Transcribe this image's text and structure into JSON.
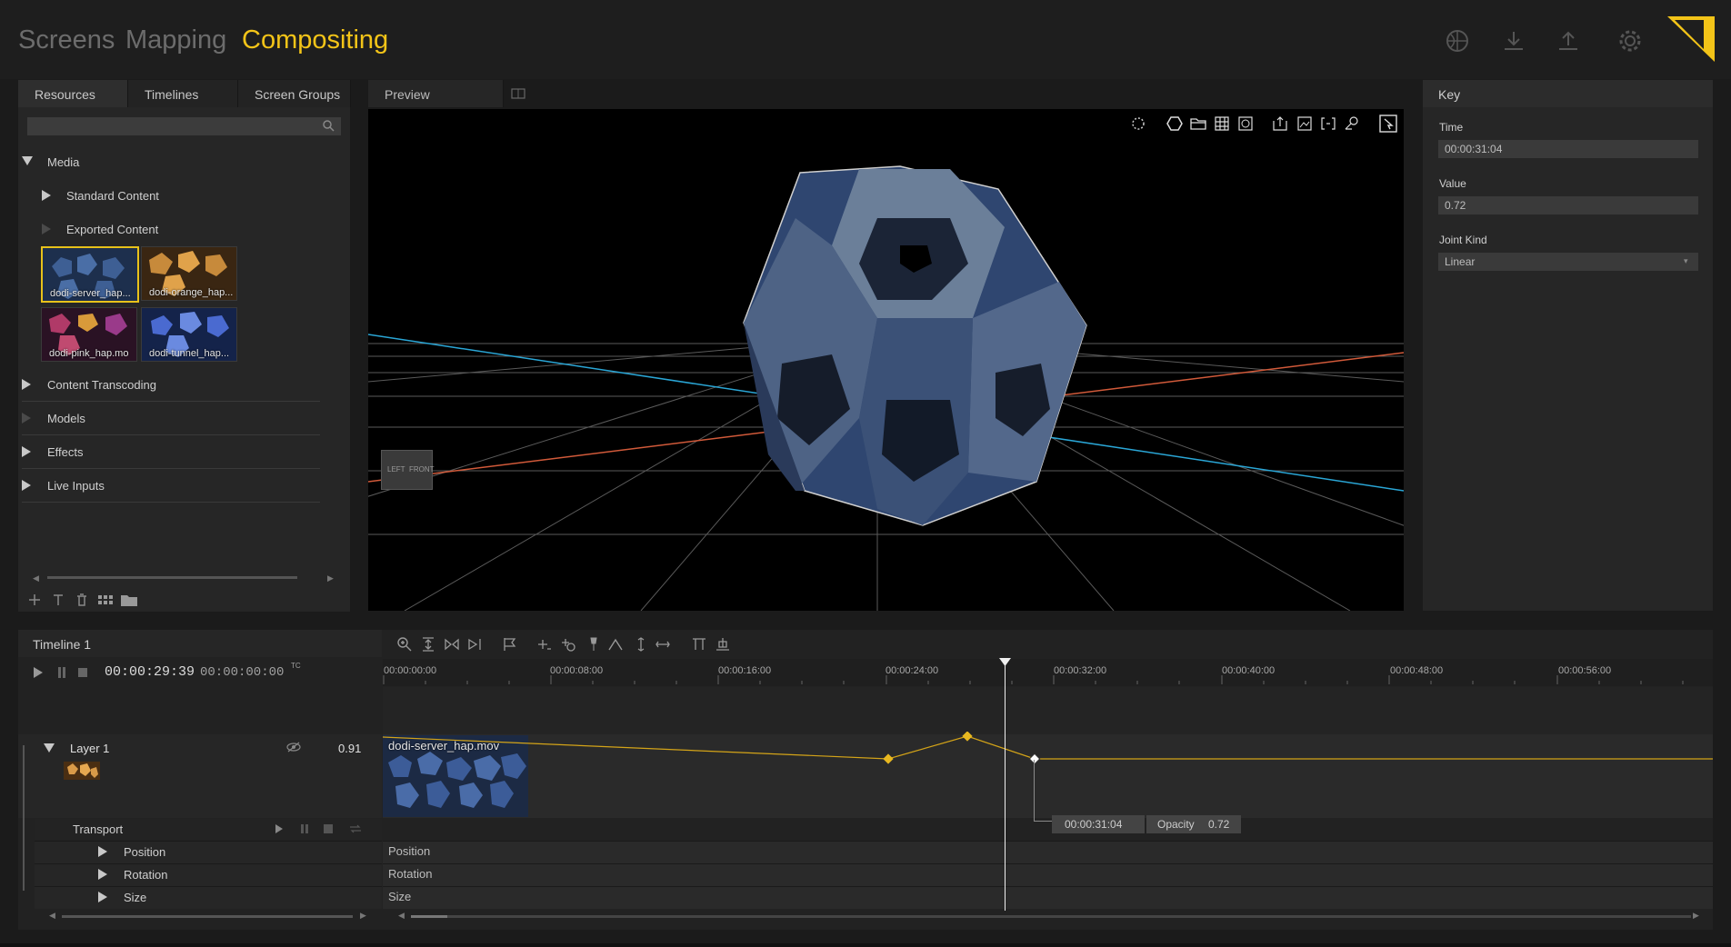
{
  "nav": {
    "tabs": [
      "Screens",
      "Mapping",
      "Compositing"
    ],
    "active": "Compositing"
  },
  "top_icons": [
    "globe-icon",
    "download-icon",
    "upload-icon",
    "gear-icon",
    "logo-icon"
  ],
  "left_panel": {
    "tabs": [
      "Resources",
      "Timelines",
      "Screen Groups"
    ],
    "search": {
      "placeholder": "",
      "value": ""
    },
    "tree": {
      "media": "Media",
      "standard_content": "Standard Content",
      "exported_content": "Exported Content",
      "content_transcoding": "Content Transcoding",
      "models": "Models",
      "effects": "Effects",
      "live_inputs": "Live Inputs"
    },
    "thumbnails": [
      "dodi-server_hap...",
      "dodi-orange_hap...",
      "dodi-pink_hap.mo",
      "dodi-tunnel_hap..."
    ]
  },
  "preview": {
    "tab": "Preview",
    "viewcube": {
      "left": "LEFT",
      "front": "FRONT"
    }
  },
  "key_panel": {
    "title": "Key",
    "time_label": "Time",
    "time_value": "00:00:31:04",
    "value_label": "Value",
    "value_value": "0.72",
    "joint_label": "Joint Kind",
    "joint_value": "Linear"
  },
  "timeline": {
    "title": "Timeline 1",
    "current_time": "00:00:29:39",
    "offset_time": "00:00:00:00",
    "tc_label": "TC",
    "ruler": [
      "00:00:00:00",
      "00:00:08:00",
      "00:00:16:00",
      "00:00:24:00",
      "00:00:32:00",
      "00:00:40:00",
      "00:00:48:00",
      "00:00:56:00"
    ],
    "layer": {
      "name": "Layer 1",
      "value": "0.91",
      "clip": "dodi-server_hap.mov"
    },
    "transport_label": "Transport",
    "properties": [
      "Position",
      "Rotation",
      "Size"
    ],
    "tooltip": {
      "time": "00:00:31:04",
      "label": "Opacity",
      "value": "0.72"
    }
  }
}
